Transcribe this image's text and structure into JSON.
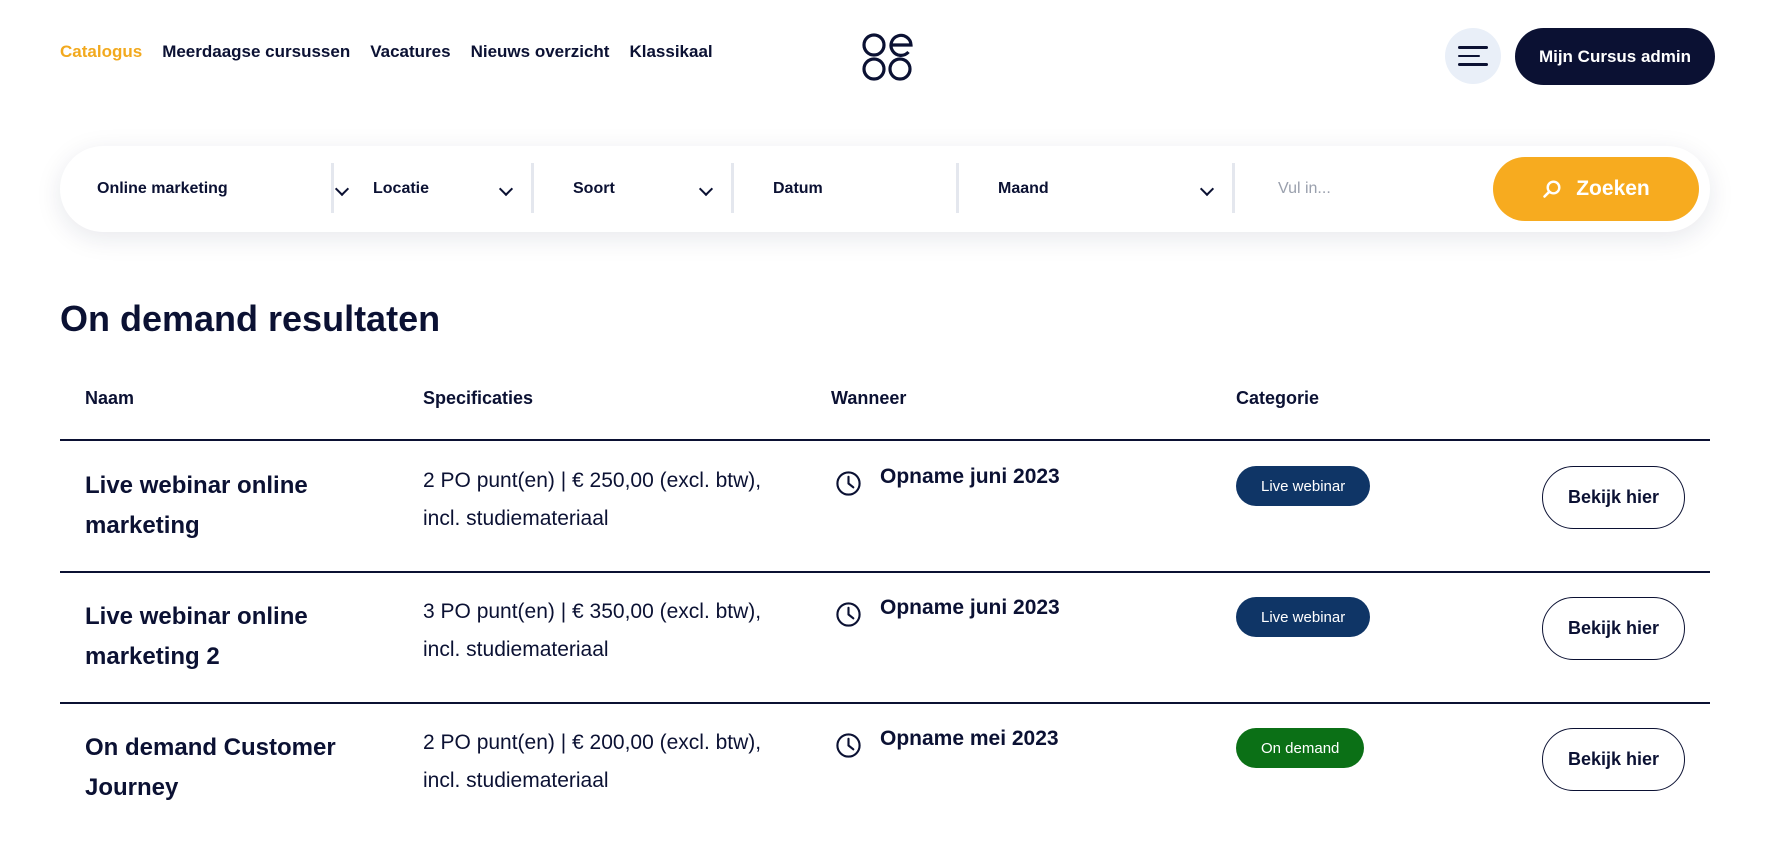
{
  "nav": {
    "items": [
      {
        "label": "Catalogus",
        "active": true
      },
      {
        "label": "Meerdaagse cursussen",
        "active": false
      },
      {
        "label": "Vacatures",
        "active": false
      },
      {
        "label": "Nieuws overzicht",
        "active": false
      },
      {
        "label": "Klassikaal",
        "active": false
      }
    ]
  },
  "header": {
    "logo_icon": "brand-logo-icon",
    "menu_icon": "hamburger-menu-icon",
    "admin_label": "Mijn Cursus admin"
  },
  "search": {
    "filters": {
      "category": "Online marketing",
      "location": "Locatie",
      "type": "Soort",
      "date": "Datum",
      "month": "Maand"
    },
    "placeholder": "Vul in...",
    "button_label": "Zoeken",
    "button_icon": "search-icon"
  },
  "results": {
    "title": "On demand resultaten",
    "columns": {
      "name": "Naam",
      "specs": "Specificaties",
      "when": "Wanneer",
      "category": "Categorie"
    },
    "rows": [
      {
        "name": "Live webinar online marketing",
        "specs": "2 PO punt(en) | € 250,00 (excl. btw), incl. studiemateriaal",
        "when": "Opname juni 2023",
        "category": "Live webinar",
        "button": "Bekijk hier"
      },
      {
        "name": "Live webinar online marketing 2",
        "specs": "3 PO punt(en) | € 350,00 (excl. btw), incl. studiemateriaal",
        "when": "Opname juni 2023",
        "category": "Live webinar",
        "button": "Bekijk hier"
      },
      {
        "name": "On demand Customer Journey",
        "specs": "2 PO punt(en) | € 200,00 (excl. btw), incl. studiemateriaal",
        "when": "Opname mei 2023",
        "category": "On demand",
        "button": "Bekijk hier"
      }
    ]
  },
  "colors": {
    "navy": "#0b1133",
    "accent": "#f7ab1f",
    "badge_live_webinar": "#0f3566",
    "badge_on_demand": "#0b7016"
  }
}
